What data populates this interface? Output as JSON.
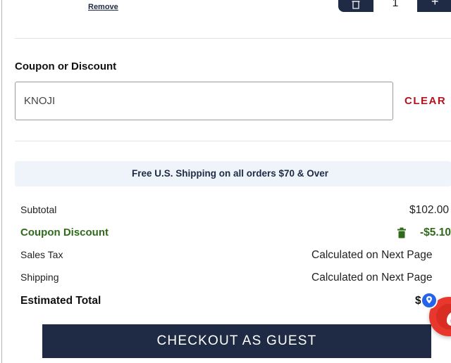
{
  "cart_item": {
    "remove_label": "Remove",
    "quantity": "1",
    "increment_symbol": "+"
  },
  "coupon": {
    "heading": "Coupon or Discount",
    "value": "KNOJI",
    "clear_label": "CLEAR"
  },
  "shipping_banner": "Free U.S. Shipping on all orders $70 & Over",
  "summary": {
    "subtotal_label": "Subtotal",
    "subtotal_value": "$102.00",
    "discount_label": "Coupon Discount",
    "discount_value": "-$5.10",
    "tax_label": "Sales Tax",
    "tax_value": "Calculated on Next Page",
    "shipping_label": "Shipping",
    "shipping_value": "Calculated on Next Page",
    "total_label": "Estimated Total",
    "total_value": "$"
  },
  "checkout_label": "CHECKOUT AS GUEST",
  "colors": {
    "navy": "#1f2a44",
    "clear_red": "#b3121e",
    "discount_green": "#2f6b1b",
    "banner_bg": "#eef4f9"
  },
  "icons": {
    "qty_remove": "trash-icon",
    "discount_remove": "trash-icon",
    "floating_app": "chat-badge-icon",
    "location": "location-pin-icon"
  }
}
